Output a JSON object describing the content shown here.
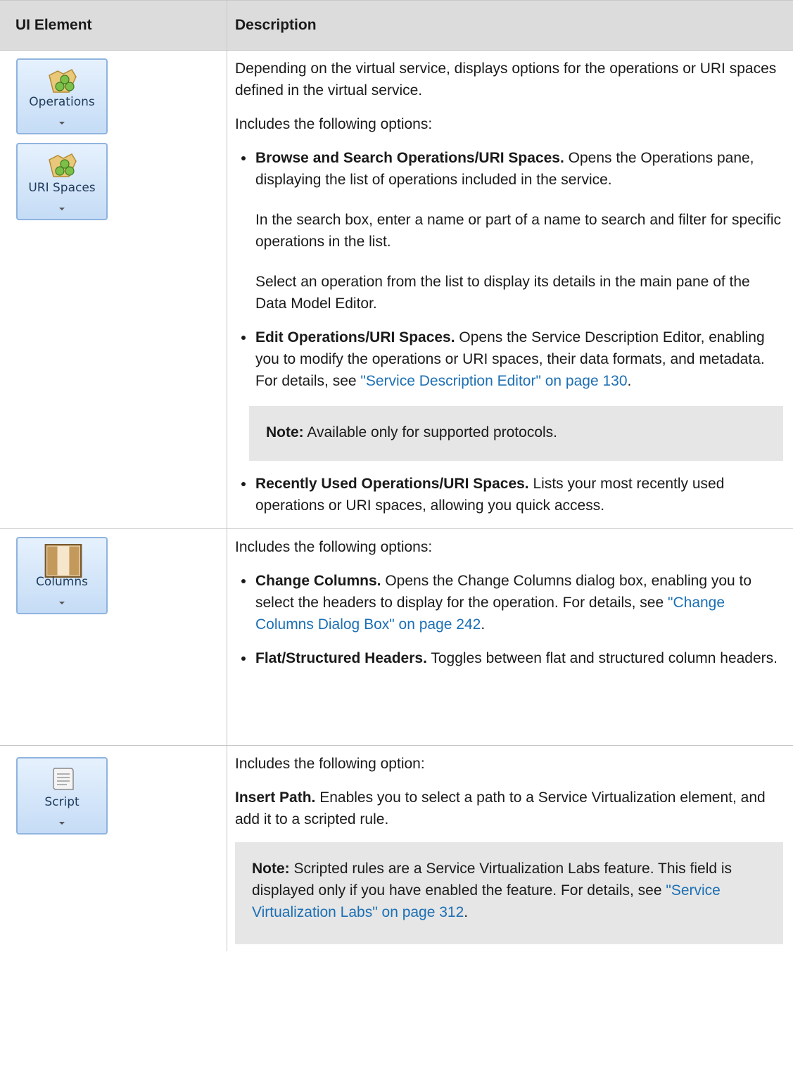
{
  "header": {
    "col_ui": "UI Element",
    "col_desc": "Description"
  },
  "rows": [
    {
      "icons": [
        {
          "label": "Operations",
          "icon": "operations-icon"
        },
        {
          "label": "URI Spaces",
          "icon": "uri-spaces-icon"
        }
      ],
      "intro": "Depending on the virtual service, displays options for the operations or URI spaces defined in the virtual service.",
      "includes": "Includes the following options:",
      "items": [
        {
          "title": "Browse and Search Operations/URI Spaces.",
          "text": " Opens the Operations pane, displaying the list of operations included in the service.",
          "para2": "In the search box, enter a name or part of a name to search and filter for specific operations in the list.",
          "para3": "Select an operation from the list to display its details in the main pane of the Data Model Editor."
        },
        {
          "title": "Edit Operations/URI Spaces.",
          "text": " Opens the Service Description Editor, enabling you to modify the operations or URI spaces, their data formats, and metadata. For details, see ",
          "link": "\"Service Description Editor\" on page 130",
          "after": ".",
          "note_label": "Note:",
          "note_text": " Available only for supported protocols."
        },
        {
          "title": "Recently Used Operations/URI Spaces.",
          "text": " Lists your most recently used operations or URI spaces, allowing you quick access."
        }
      ]
    },
    {
      "icons": [
        {
          "label": "Columns",
          "icon": "columns-icon"
        }
      ],
      "includes": "Includes the following options:",
      "items": [
        {
          "title": "Change Columns.",
          "text": " Opens the Change Columns dialog box, enabling you to select the headers to display for the operation. For details, see ",
          "link": "\"Change Columns Dialog Box\" on page 242",
          "after": "."
        },
        {
          "title": "Flat/Structured Headers.",
          "text": " Toggles between flat and structured column headers."
        }
      ]
    },
    {
      "icons": [
        {
          "label": "Script",
          "icon": "script-icon"
        }
      ],
      "includes": "Includes the following option:",
      "insert_title": "Insert Path.",
      "insert_text": " Enables you to select a path to a Service Virtualization element, and add it to a scripted rule.",
      "note_label": "Note:",
      "note_text": " Scripted rules are a Service Virtualization Labs feature. This field is displayed only if you have enabled the feature. For details, see ",
      "note_link": "\"Service Virtualization Labs\" on page 312",
      "note_after": "."
    }
  ]
}
